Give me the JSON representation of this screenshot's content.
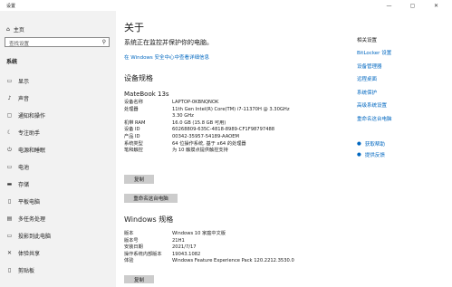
{
  "window": {
    "title": "设置",
    "min": "—",
    "max": "▢",
    "close": "✕"
  },
  "sidebar": {
    "home": "主页",
    "search_placeholder": "查找设置",
    "section": "系统",
    "items": [
      {
        "label": "显示",
        "icon": "display-icon",
        "glyph": "▭"
      },
      {
        "label": "声音",
        "icon": "sound-icon",
        "glyph": "♪"
      },
      {
        "label": "通知和操作",
        "icon": "notification-icon",
        "glyph": "▢"
      },
      {
        "label": "专注助手",
        "icon": "focus-assist-icon",
        "glyph": "☾"
      },
      {
        "label": "电源和睡眠",
        "icon": "power-icon",
        "glyph": "⏻"
      },
      {
        "label": "电池",
        "icon": "battery-icon",
        "glyph": "▭"
      },
      {
        "label": "存储",
        "icon": "storage-icon",
        "glyph": "▬"
      },
      {
        "label": "平板电脑",
        "icon": "tablet-icon",
        "glyph": "▯"
      },
      {
        "label": "多任务处理",
        "icon": "multitasking-icon",
        "glyph": "▤"
      },
      {
        "label": "投影到此电脑",
        "icon": "projecting-icon",
        "glyph": "▭"
      },
      {
        "label": "体验共享",
        "icon": "shared-experiences-icon",
        "glyph": "✕"
      },
      {
        "label": "剪贴板",
        "icon": "clipboard-icon",
        "glyph": "▯"
      }
    ]
  },
  "main": {
    "title": "关于",
    "protect_text": "系统正在监控并保护你的电脑。",
    "security_link": "在 Windows 安全中心中查看详细信息",
    "device_spec_heading": "设备规格",
    "device_name": "MateBook 13s",
    "device_specs": [
      {
        "k": "设备名称",
        "v": "LAPTOP-0KBNQNOK"
      },
      {
        "k": "处理器",
        "v": "11th Gen Intel(R) Core(TM) i7-11370H @ 3.30GHz"
      },
      {
        "k": "",
        "v": "3.30 GHz"
      },
      {
        "k": "机带 RAM",
        "v": "16.0 GB (15.8 GB 可用)"
      },
      {
        "k": "设备 ID",
        "v": "60268809-635C-4818-8989-CF1F98797488"
      },
      {
        "k": "产品 ID",
        "v": "00342-35957-54189-AAOEM"
      },
      {
        "k": "系统类型",
        "v": "64 位操作系统, 基于 x64 的处理器"
      },
      {
        "k": "笔和触控",
        "v": "为 10 触摸点提供触控支持"
      }
    ],
    "copy_label": "复制",
    "rename_label": "重命名这台电脑",
    "windows_heading": "Windows 规格",
    "windows_specs": [
      {
        "k": "版本",
        "v": "Windows 10 家庭中文版"
      },
      {
        "k": "版本号",
        "v": "21H1"
      },
      {
        "k": "安装日期",
        "v": "2021/7/17"
      },
      {
        "k": "操作系统内部版本",
        "v": "19043.1082"
      },
      {
        "k": "体验",
        "v": "Windows Feature Experience Pack 120.2212.3530.0"
      }
    ]
  },
  "related": {
    "title": "相关设置",
    "links": [
      "BitLocker 设置",
      "设备管理器",
      "远程桌面",
      "系统保护",
      "高级系统设置",
      "重命名这台电脑"
    ]
  },
  "help": {
    "get_help": "获取帮助",
    "feedback": "提供反馈"
  },
  "colors": {
    "accent": "#0067c0",
    "sidebar_bg": "#f2f2f2",
    "button_bg": "#cccccc"
  }
}
